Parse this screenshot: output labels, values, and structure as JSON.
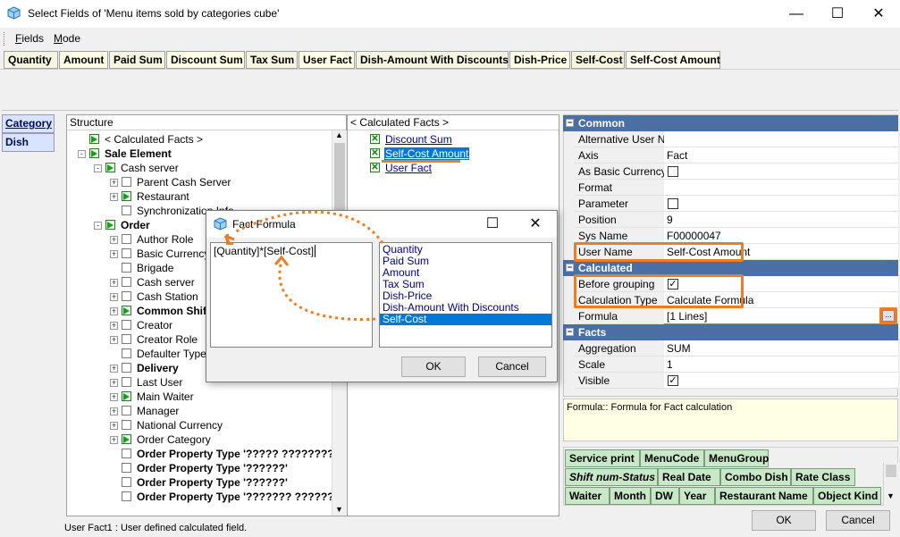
{
  "window": {
    "title": "Select Fields of 'Menu items sold by categories cube'",
    "minimize": "—",
    "maximize": "☐",
    "close": "✕"
  },
  "menu": {
    "fields": "Fields",
    "mode": "Mode"
  },
  "field_bar": [
    "Quantity",
    "Amount",
    "Paid Sum",
    "Discount Sum",
    "Tax Sum",
    "User Fact",
    "Dish-Amount With Discounts",
    "Dish-Price",
    "Self-Cost",
    "Self-Cost Amount"
  ],
  "left_buttons": [
    "Category",
    "Dish"
  ],
  "structure": {
    "header": "Structure",
    "rows": [
      {
        "label": "< Calculated Facts >",
        "indent": 1,
        "icon": "green",
        "bold": false
      },
      {
        "label": "Sale Element",
        "indent": 0,
        "icon": "green",
        "bold": true,
        "exp": "-"
      },
      {
        "label": "Cash server",
        "indent": 1,
        "icon": "green",
        "bold": false,
        "exp": "-"
      },
      {
        "label": "Parent Cash Server",
        "indent": 2,
        "icon": "box",
        "bold": false,
        "exp": "+"
      },
      {
        "label": "Restaurant",
        "indent": 2,
        "icon": "green",
        "bold": false,
        "exp": "+"
      },
      {
        "label": "Synchronization Info",
        "indent": 2,
        "icon": "box",
        "bold": false
      },
      {
        "label": "Order",
        "indent": 1,
        "icon": "green",
        "bold": true,
        "exp": "-"
      },
      {
        "label": "Author Role",
        "indent": 2,
        "icon": "box",
        "bold": false,
        "exp": "+"
      },
      {
        "label": "Basic Currency",
        "indent": 2,
        "icon": "box",
        "bold": false,
        "exp": "+"
      },
      {
        "label": "Brigade",
        "indent": 2,
        "icon": "box",
        "bold": false
      },
      {
        "label": "Cash server",
        "indent": 2,
        "icon": "box",
        "bold": false,
        "exp": "+"
      },
      {
        "label": "Cash Station",
        "indent": 2,
        "icon": "box",
        "bold": false,
        "exp": "+"
      },
      {
        "label": "Common Shift",
        "indent": 2,
        "icon": "green",
        "bold": true,
        "exp": "+"
      },
      {
        "label": "Creator",
        "indent": 2,
        "icon": "box",
        "bold": false,
        "exp": "+"
      },
      {
        "label": "Creator Role",
        "indent": 2,
        "icon": "box",
        "bold": false,
        "exp": "+"
      },
      {
        "label": "Defaulter Type",
        "indent": 2,
        "icon": "box",
        "bold": false
      },
      {
        "label": "Delivery",
        "indent": 2,
        "icon": "box",
        "bold": true,
        "exp": "+"
      },
      {
        "label": "Last User",
        "indent": 2,
        "icon": "box",
        "bold": false,
        "exp": "+"
      },
      {
        "label": "Main Waiter",
        "indent": 2,
        "icon": "green",
        "bold": false,
        "exp": "+"
      },
      {
        "label": "Manager",
        "indent": 2,
        "icon": "box",
        "bold": false,
        "exp": "+"
      },
      {
        "label": "National Currency",
        "indent": 2,
        "icon": "box",
        "bold": false,
        "exp": "+"
      },
      {
        "label": "Order Category",
        "indent": 2,
        "icon": "green",
        "bold": false,
        "exp": "+"
      },
      {
        "label": "Order Property Type '????? ????????",
        "indent": 2,
        "icon": "box",
        "bold": true
      },
      {
        "label": "Order Property Type '??????'",
        "indent": 2,
        "icon": "box",
        "bold": true
      },
      {
        "label": "Order Property Type '??????'",
        "indent": 2,
        "icon": "box",
        "bold": true
      },
      {
        "label": "Order Property Type '??????? ??????",
        "indent": 2,
        "icon": "box",
        "bold": true
      }
    ]
  },
  "calc_facts": {
    "header": "< Calculated Facts >",
    "items": [
      "Discount Sum",
      "Self-Cost Amount",
      "User Fact"
    ],
    "selected": 1
  },
  "props": {
    "common": "Common",
    "calculated": "Calculated",
    "facts": "Facts",
    "rows_common": [
      {
        "name": "Alternative User Na",
        "value": ""
      },
      {
        "name": "Axis",
        "value": "Fact"
      },
      {
        "name": "As Basic Currency",
        "value": "",
        "check": "empty"
      },
      {
        "name": "Format",
        "value": ""
      },
      {
        "name": "Parameter",
        "value": "",
        "check": "empty"
      },
      {
        "name": "Position",
        "value": "9"
      },
      {
        "name": "Sys Name",
        "value": "F00000047"
      },
      {
        "name": "User Name",
        "value": "Self-Cost Amount"
      }
    ],
    "rows_calc": [
      {
        "name": "Before grouping",
        "value": "",
        "check": "checked"
      },
      {
        "name": "Calculation Type",
        "value": "Calculate Formula"
      },
      {
        "name": "Formula",
        "value": "[1 Lines]"
      }
    ],
    "rows_facts": [
      {
        "name": "Aggregation",
        "value": "SUM"
      },
      {
        "name": "Scale",
        "value": "1"
      },
      {
        "name": "Visible",
        "value": "",
        "check": "checked"
      }
    ],
    "ellipsis": "...",
    "description": "Formula:: Formula for Fact calculation"
  },
  "dialog": {
    "title": "Fact Formula",
    "formula": "[Quantity]*[Self-Cost]",
    "list": [
      "Quantity",
      "Paid Sum",
      "Amount",
      "Tax Sum",
      "Dish-Price",
      "Dish-Amount With Discounts",
      "Self-Cost"
    ],
    "selected": 6,
    "ok": "OK",
    "cancel": "Cancel"
  },
  "bottom_tags": {
    "row1": [
      "Service print",
      "MenuCode",
      "MenuGroup"
    ],
    "row2": [
      "Shift num-Status",
      "Real Date",
      "Combo Dish",
      "Rate Class"
    ],
    "row3": [
      "Waiter",
      "Month",
      "DW",
      "Year",
      "Restaurant Name",
      "Object Kind"
    ]
  },
  "footer": {
    "ok": "OK",
    "cancel": "Cancel",
    "status": "User Fact1 : User defined calculated field."
  },
  "accent": "#f07c22"
}
